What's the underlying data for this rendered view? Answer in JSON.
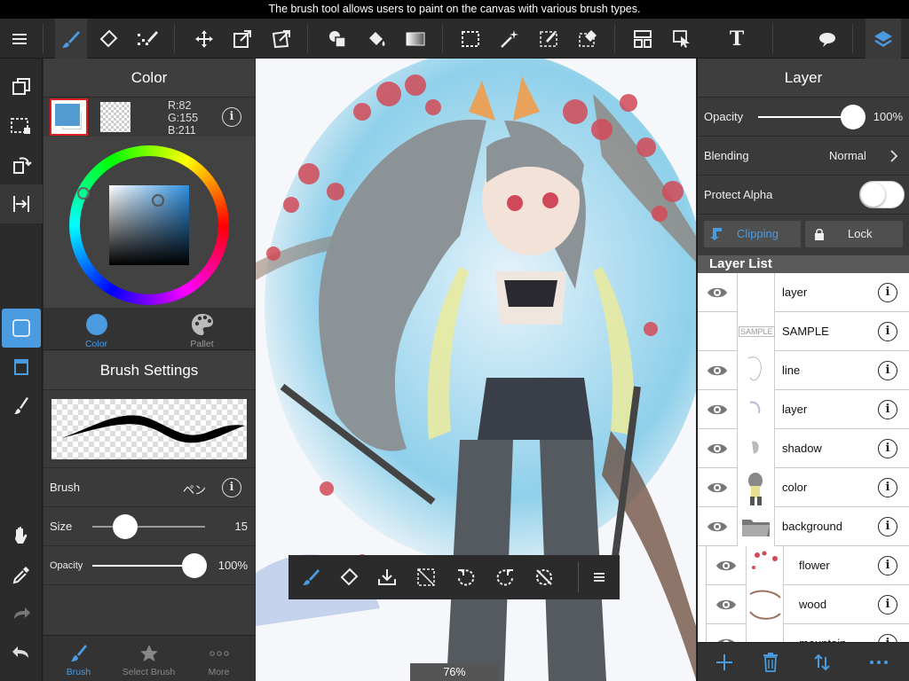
{
  "caption": "The brush tool allows users to paint on the canvas with various brush types.",
  "colors": {
    "accent": "#4a9be0",
    "current_color": "#529bd3",
    "panel": "#3a3a3a",
    "toolbar": "#2b2b2b"
  },
  "toolbar": {
    "items": [
      "menu-icon",
      "brush-icon",
      "eraser-icon",
      "dot-brush-icon",
      "move-icon",
      "transform-icon",
      "free-transform-icon",
      "fill-shape-icon",
      "bucket-icon",
      "gradient-icon",
      "select-rect-icon",
      "magic-wand-icon",
      "select-pen-icon",
      "select-eraser-icon",
      "layout-icon",
      "select-arrow-icon",
      "text-icon",
      "speech-bubble-icon",
      "layers-icon"
    ],
    "text_tool_label": "T"
  },
  "color_panel": {
    "title": "Color",
    "rgb": {
      "r": "R:82",
      "g": "G:155",
      "b": "B:211"
    },
    "tabs": [
      {
        "label": "Color",
        "active": true
      },
      {
        "label": "Pallet",
        "active": false
      }
    ]
  },
  "brush_settings": {
    "title": "Brush Settings",
    "brush": {
      "label": "Brush",
      "value": "ペン"
    },
    "size": {
      "label": "Size",
      "value": "15",
      "level": 0.3
    },
    "opacity": {
      "label": "Opacity",
      "value": "100%",
      "level": 1.0
    },
    "tabs": [
      {
        "label": "Brush",
        "active": true
      },
      {
        "label": "Select Brush",
        "active": false
      },
      {
        "label": "More",
        "active": false
      }
    ]
  },
  "canvas": {
    "zoom": "76%"
  },
  "layer_panel": {
    "title": "Layer",
    "opacity": {
      "label": "Opacity",
      "value": "100%",
      "level": 1.0
    },
    "blending": {
      "label": "Blending",
      "value": "Normal"
    },
    "protect_alpha": {
      "label": "Protect Alpha",
      "on": false
    },
    "clipping_label": "Clipping",
    "lock_label": "Lock",
    "list_title": "Layer List",
    "layers": [
      {
        "name": "layer",
        "visible": true
      },
      {
        "name": "SAMPLE",
        "visible": false,
        "thumb_text": "SAMPLE"
      },
      {
        "name": "line",
        "visible": true
      },
      {
        "name": "layer",
        "visible": true
      },
      {
        "name": "shadow",
        "visible": true
      },
      {
        "name": "color",
        "visible": true
      },
      {
        "name": "background",
        "visible": true,
        "folder": true
      },
      {
        "name": "flower",
        "visible": true,
        "child": true
      },
      {
        "name": "wood",
        "visible": true,
        "child": true
      },
      {
        "name": "mountain",
        "visible": true,
        "child": true
      }
    ]
  }
}
